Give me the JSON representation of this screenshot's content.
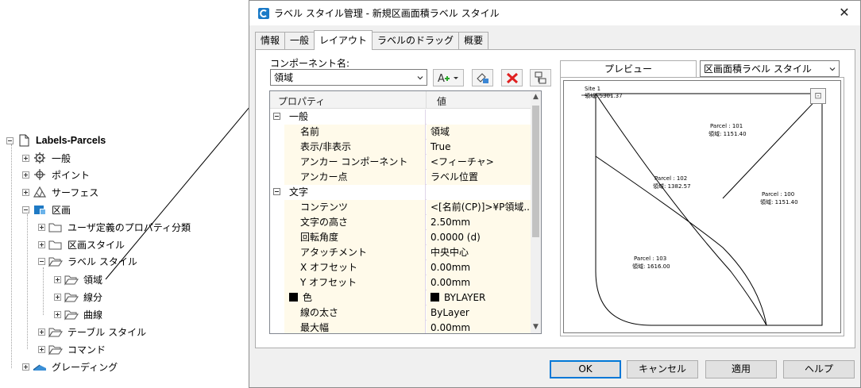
{
  "tree": {
    "root": "Labels-Parcels",
    "items": [
      {
        "label": "一般",
        "icon": "gear-icon"
      },
      {
        "label": "ポイント",
        "icon": "point-icon"
      },
      {
        "label": "サーフェス",
        "icon": "surface-icon"
      },
      {
        "label": "区画",
        "icon": "parcel-icon"
      },
      {
        "label": "ユーザ定義のプロパティ分類",
        "icon": "folder-icon"
      },
      {
        "label": "区画スタイル",
        "icon": "folder-icon"
      },
      {
        "label": "ラベル スタイル",
        "icon": "folder-open-icon"
      },
      {
        "label": "領域",
        "icon": "folder-icon"
      },
      {
        "label": "線分",
        "icon": "folder-icon"
      },
      {
        "label": "曲線",
        "icon": "folder-icon"
      },
      {
        "label": "テーブル スタイル",
        "icon": "folder-icon"
      },
      {
        "label": "コマンド",
        "icon": "folder-icon"
      },
      {
        "label": "グレーディング",
        "icon": "grading-icon"
      }
    ]
  },
  "dialog": {
    "title": "ラベル スタイル管理 - 新規区画面積ラベル スタイル",
    "tabs": [
      "情報",
      "一般",
      "レイアウト",
      "ラベルのドラッグ",
      "概要"
    ],
    "active_tab": "レイアウト",
    "component_label": "コンポーネント名:",
    "component_value": "領域",
    "grid": {
      "col_property": "プロパティ",
      "col_value": "値",
      "rows": [
        {
          "kind": "cat",
          "name": "一般",
          "value": ""
        },
        {
          "kind": "item",
          "name": "名前",
          "value": "領域"
        },
        {
          "kind": "item",
          "name": "表示/非表示",
          "value": "True"
        },
        {
          "kind": "item",
          "name": "アンカー コンポーネント",
          "value": "<フィーチャ>"
        },
        {
          "kind": "item",
          "name": "アンカー点",
          "value": "ラベル位置"
        },
        {
          "kind": "cat",
          "name": "文字",
          "value": ""
        },
        {
          "kind": "item",
          "name": "コンテンツ",
          "value": "<[名前(CP)]>¥P領域..."
        },
        {
          "kind": "item",
          "name": "文字の高さ",
          "value": "2.50mm"
        },
        {
          "kind": "item",
          "name": "回転角度",
          "value": "0.0000 (d)"
        },
        {
          "kind": "item",
          "name": "アタッチメント",
          "value": "中央中心"
        },
        {
          "kind": "item",
          "name": "X オフセット",
          "value": "0.00mm"
        },
        {
          "kind": "item",
          "name": "Y オフセット",
          "value": "0.00mm"
        },
        {
          "kind": "color",
          "name": "色",
          "value": "BYLAYER"
        },
        {
          "kind": "item",
          "name": "線の太さ",
          "value": "ByLayer"
        },
        {
          "kind": "item",
          "name": "最大幅",
          "value": "0.00mm"
        }
      ]
    },
    "preview": {
      "tab_label": "プレビュー",
      "style_select": "区画面積ラベル スタイル",
      "site_label": "Site 1",
      "site_area": "領域: 5301.37",
      "parcels": [
        {
          "name": "Parcel : 101",
          "area": "領域: 1151.40"
        },
        {
          "name": "Parcel : 102",
          "area": "領域: 1382.57"
        },
        {
          "name": "Parcel : 100",
          "area": "領域: 1151.40"
        },
        {
          "name": "Parcel : 103",
          "area": "領域: 1616.00"
        }
      ]
    },
    "buttons": {
      "ok": "OK",
      "cancel": "キャンセル",
      "apply": "適用",
      "help": "ヘルプ"
    }
  }
}
